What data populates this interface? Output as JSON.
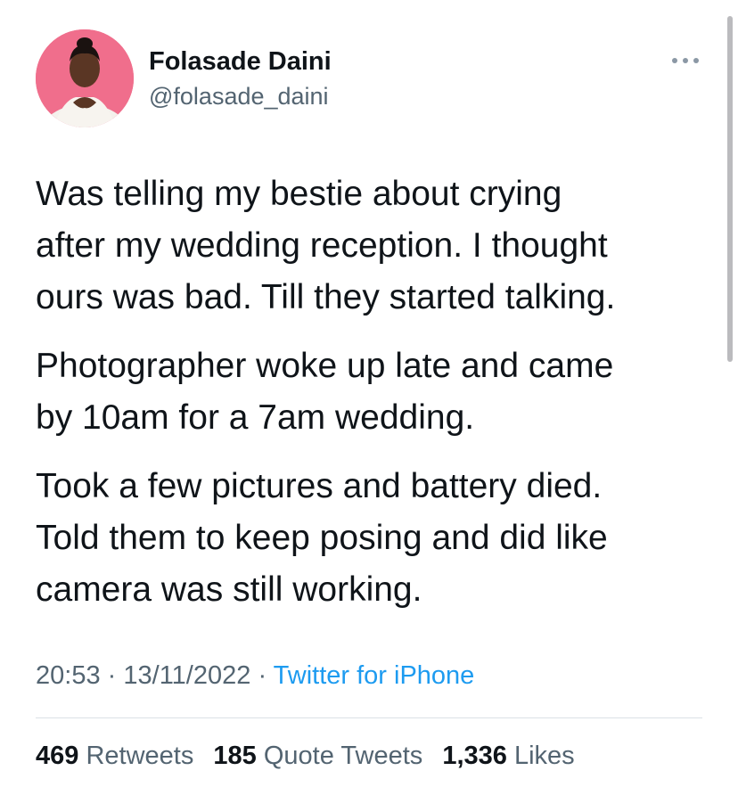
{
  "author": {
    "display_name": "Folasade Daini",
    "handle": "@folasade_daini"
  },
  "tweet": {
    "paragraphs": [
      [
        "Was telling my bestie about crying",
        "after my wedding reception. I thought",
        "ours was bad. Till they started talking."
      ],
      [
        "Photographer woke up late and came",
        "by 10am for a 7am wedding."
      ],
      [
        "Took a few pictures and battery died.",
        "Told them to keep posing and did like",
        "camera was still working."
      ]
    ],
    "time": "20:53",
    "date": "13/11/2022",
    "source": "Twitter for iPhone",
    "separator": "·"
  },
  "stats": {
    "retweets": {
      "count": "469",
      "label": "Retweets"
    },
    "quote_tweets": {
      "count": "185",
      "label": "Quote Tweets"
    },
    "likes": {
      "count": "1,336",
      "label": "Likes"
    }
  },
  "icons": {
    "more": "more-dots-icon"
  },
  "colors": {
    "text": "#0f1419",
    "secondary": "#536471",
    "link": "#1d9bf0",
    "avatar_bg": "#f06e8c"
  }
}
